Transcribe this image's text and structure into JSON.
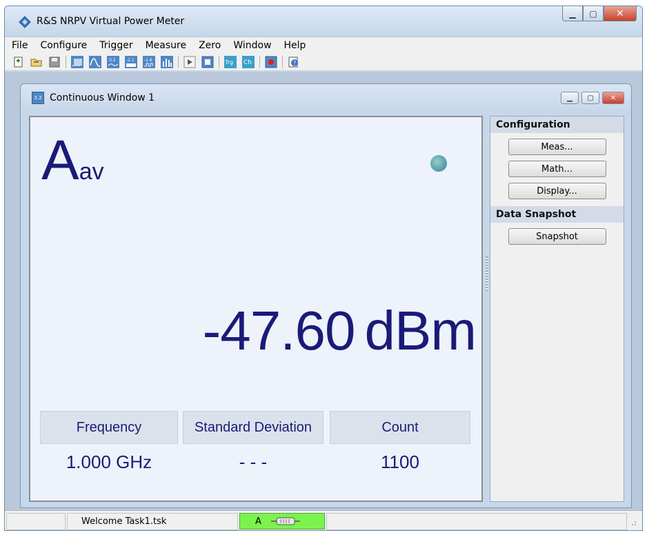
{
  "app": {
    "title": "R&S  NRPV Virtual Power Meter",
    "controls": {
      "minimize": "▁",
      "maximize": "▢",
      "close": "✕"
    }
  },
  "menu": [
    "File",
    "Configure",
    "Trigger",
    "Measure",
    "Zero",
    "Window",
    "Help"
  ],
  "toolbar": {
    "icons": [
      "new-icon",
      "open-icon",
      "save-icon",
      "pulse-icon",
      "trace-icon",
      "continuous-icon",
      "statistics-icon",
      "timeslot-icon",
      "burst-icon",
      "start-icon",
      "stop-icon",
      "trigger-icon",
      "channel-icon",
      "record-icon",
      "help-icon"
    ],
    "labels": {
      "icon_32": "3.2",
      "icon_21": "-2.1",
      "icon_16": "-1.6",
      "trg": "Trg",
      "ch": "Ch"
    }
  },
  "child_window": {
    "title": "Continuous Window 1",
    "icon_label": "3.2"
  },
  "display": {
    "measure_name": "A",
    "measure_sub": "av",
    "value": "-47.60",
    "unit": "dBm",
    "stats": [
      {
        "label": "Frequency",
        "value": "1.000 GHz"
      },
      {
        "label": "Standard Deviation",
        "value": "- - -"
      },
      {
        "label": "Count",
        "value": "1100"
      }
    ]
  },
  "side_panel": {
    "configuration_title": "Configuration",
    "meas_button": "Meas...",
    "math_button": "Math...",
    "display_button": "Display...",
    "snapshot_title": "Data Snapshot",
    "snapshot_button": "Snapshot"
  },
  "status": {
    "task": "Welcome Task1.tsk",
    "sensor": "A"
  },
  "colors": {
    "value_text": "#1a1a78",
    "badge": "#7cf24e",
    "display_bg": "#edf2fb"
  }
}
